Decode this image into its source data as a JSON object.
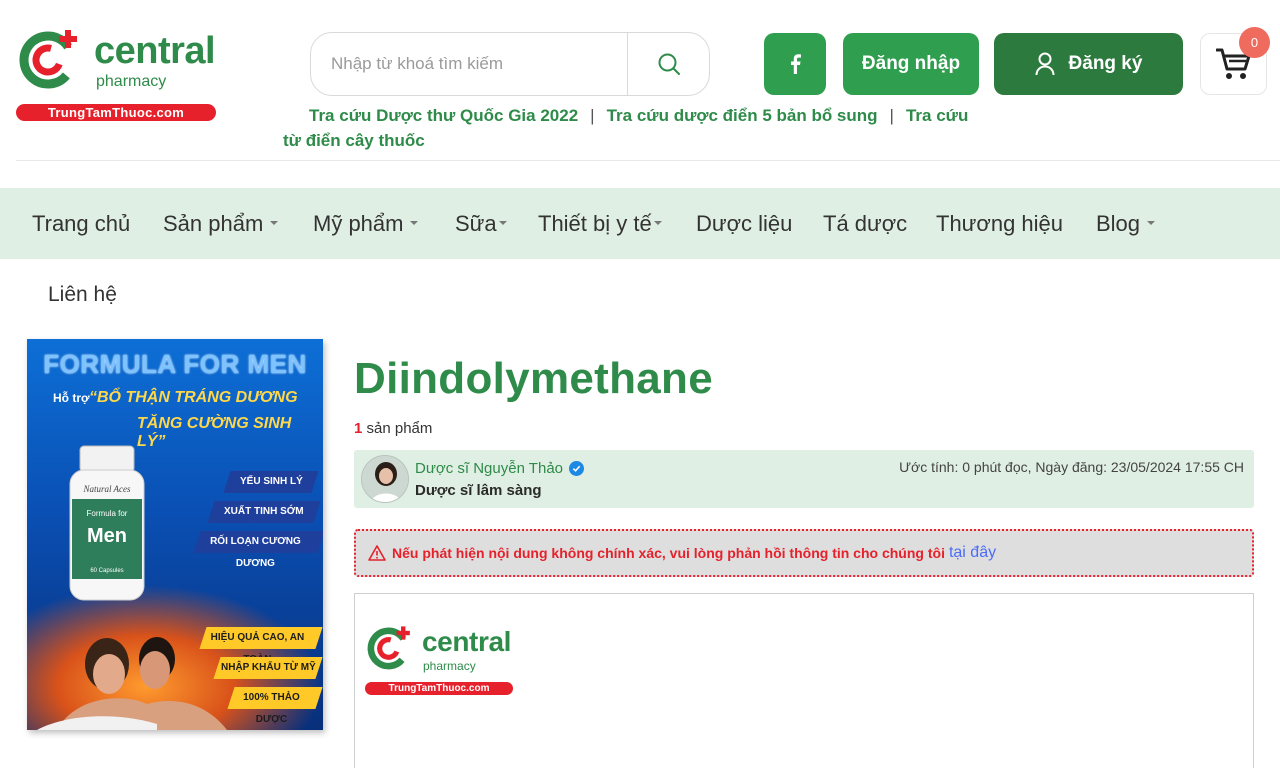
{
  "brand": {
    "name": "central",
    "sub": "pharmacy",
    "domain": "TrungTamThuoc.com",
    "green": "#2e8b49",
    "red": "#e6212b"
  },
  "search": {
    "placeholder": "Nhập từ khoá tìm kiếm"
  },
  "header_buttons": {
    "login": "Đăng nhập",
    "register": "Đăng ký",
    "cart_count": "0"
  },
  "quick_links": [
    "Tra cứu Dược thư Quốc Gia 2022",
    "Tra cứu dược điển 5 bản bổ sung",
    "Tra cứu",
    "từ điển cây thuốc"
  ],
  "quick_links_sep": "|",
  "nav": {
    "items": [
      "Trang chủ",
      "Sản phẩm",
      "Mỹ phẩm",
      "Sữa",
      "Thiết bị y tế",
      "Dược liệu",
      "Tá dược",
      "Thương hiệu",
      "Blog"
    ],
    "contact": "Liên hệ"
  },
  "banner": {
    "title": "FORMULA FOR MEN",
    "sub": "Hỗ trợ",
    "slogan1": "“BỔ THẬN TRÁNG DƯƠNG",
    "slogan2": "TĂNG CƯỜNG SINH LÝ”",
    "tags_blue": [
      "YẾU SINH LÝ",
      "XUẤT TINH SỚM",
      "RỐI LOẠN CƯƠNG DƯƠNG"
    ],
    "tags_yellow": [
      "HIỆU QUẢ CAO, AN TOÀN",
      "NHẬP KHẨU TỪ MỸ",
      "100% THẢO DƯỢC"
    ],
    "bottle_label": "Men",
    "bottle_brand": "Natural Aces",
    "bottle_top": "Formula for",
    "bottle_caps": "60 Capsules"
  },
  "article": {
    "title": "Diindolymethane",
    "count_num": "1",
    "count_label": "sản phẩm",
    "author_name": "Dược sĩ Nguyễn Thảo",
    "author_role": "Dược sĩ lâm sàng",
    "meta": "Ước tính: 0 phút đọc, Ngày đăng: 23/05/2024 17:55 CH",
    "warning": "Nếu phát hiện nội dung không chính xác, vui lòng phản hồi thông tin cho chúng tôi",
    "warning_link": "tại đây"
  }
}
